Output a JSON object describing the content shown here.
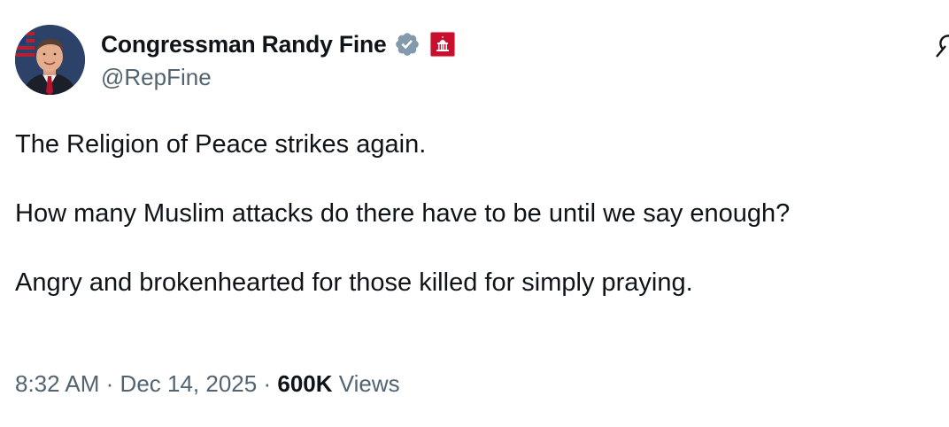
{
  "author": {
    "display_name": "Congressman Randy Fine",
    "handle": "@RepFine",
    "verified_badge_icon": "verified-badge-icon",
    "affiliation_icon": "us-house-capitol-icon"
  },
  "tweet": {
    "paragraphs": [
      "The Religion of Peace strikes again.",
      "How many Muslim attacks do there have to be until we say enough?",
      "Angry and brokenhearted for those killed for simply praying."
    ]
  },
  "meta": {
    "time": "8:32 AM",
    "separator": "·",
    "date": "Dec 14, 2025",
    "views_count": "600K",
    "views_label": "Views"
  },
  "colors": {
    "text": "#0f1419",
    "secondary": "#536471",
    "verified_badge": "#829aab",
    "affiliation_badge": "#c8102e"
  }
}
